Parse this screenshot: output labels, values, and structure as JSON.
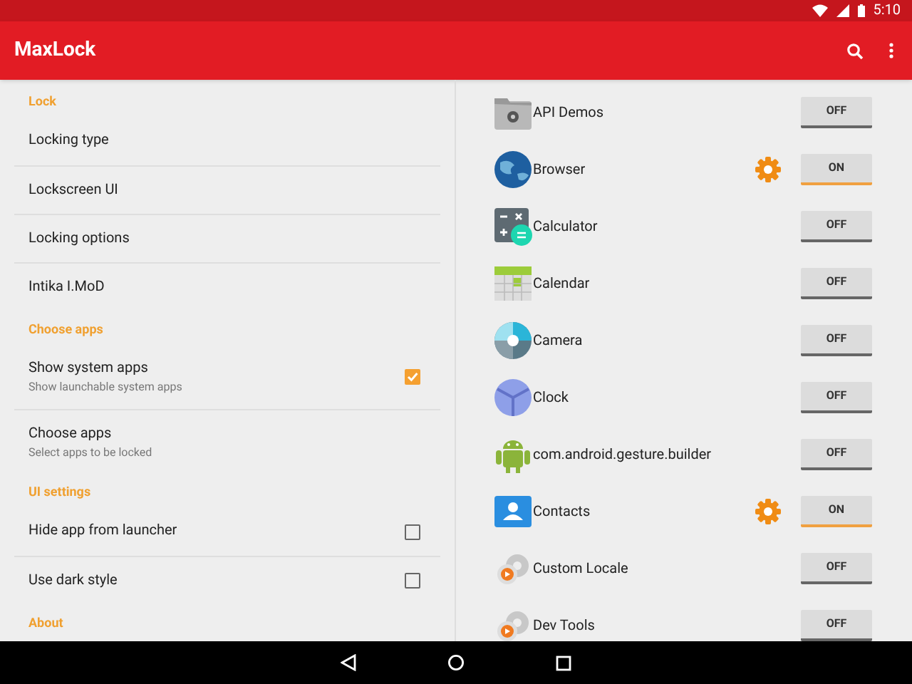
{
  "status_bar": {
    "time": "5:10"
  },
  "app_bar": {
    "title": "MaxLock"
  },
  "settings": [
    {
      "kind": "header",
      "title": "Lock"
    },
    {
      "kind": "item",
      "title": "Locking type"
    },
    {
      "kind": "item",
      "title": "Lockscreen UI"
    },
    {
      "kind": "item",
      "title": "Locking options"
    },
    {
      "kind": "item",
      "title": "Intika I.MoD"
    },
    {
      "kind": "header",
      "title": "Choose apps"
    },
    {
      "kind": "check",
      "title": "Show system apps",
      "summary": "Show launchable system apps",
      "checked": true
    },
    {
      "kind": "item",
      "title": "Choose apps",
      "summary": "Select apps to be locked"
    },
    {
      "kind": "header",
      "title": "UI settings"
    },
    {
      "kind": "check",
      "title": "Hide app from launcher",
      "checked": false
    },
    {
      "kind": "check",
      "title": "Use dark style",
      "checked": false
    },
    {
      "kind": "header",
      "title": "About"
    }
  ],
  "apps": [
    {
      "name": "API Demos",
      "toggle": "OFF",
      "on": false
    },
    {
      "name": "Browser",
      "toggle": "ON",
      "on": true
    },
    {
      "name": "Calculator",
      "toggle": "OFF",
      "on": false
    },
    {
      "name": "Calendar",
      "toggle": "OFF",
      "on": false
    },
    {
      "name": "Camera",
      "toggle": "OFF",
      "on": false
    },
    {
      "name": "Clock",
      "toggle": "OFF",
      "on": false
    },
    {
      "name": "com.android.gesture.builder",
      "toggle": "OFF",
      "on": false
    },
    {
      "name": "Contacts",
      "toggle": "ON",
      "on": true
    },
    {
      "name": "Custom Locale",
      "toggle": "OFF",
      "on": false
    },
    {
      "name": "Dev Tools",
      "toggle": "OFF",
      "on": false
    }
  ]
}
